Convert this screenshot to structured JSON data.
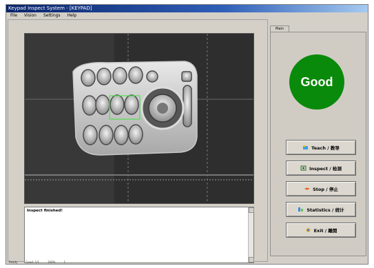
{
  "window": {
    "title": "Keypad Inspect System - [KEYPAD]"
  },
  "menu": {
    "items": [
      "File",
      "Vision",
      "Settings",
      "Help"
    ]
  },
  "log": {
    "text": "Inspect finished!"
  },
  "tab": {
    "label": "Main"
  },
  "status": {
    "result": "Good",
    "color": "#0a8a0a"
  },
  "buttons": {
    "teach": "Teach / 教导",
    "inspect": "Inspect / 检测",
    "stop": "Stop / 停止",
    "statistics": "Statistics / 统计",
    "exit": "Exit / 離開"
  },
  "statusbar": {
    "items": [
      "Ready",
      "Good: 1/1",
      "100%",
      "1"
    ]
  },
  "icons": [
    "teach-icon",
    "inspect-icon",
    "stop-icon",
    "statistics-icon",
    "exit-icon"
  ]
}
